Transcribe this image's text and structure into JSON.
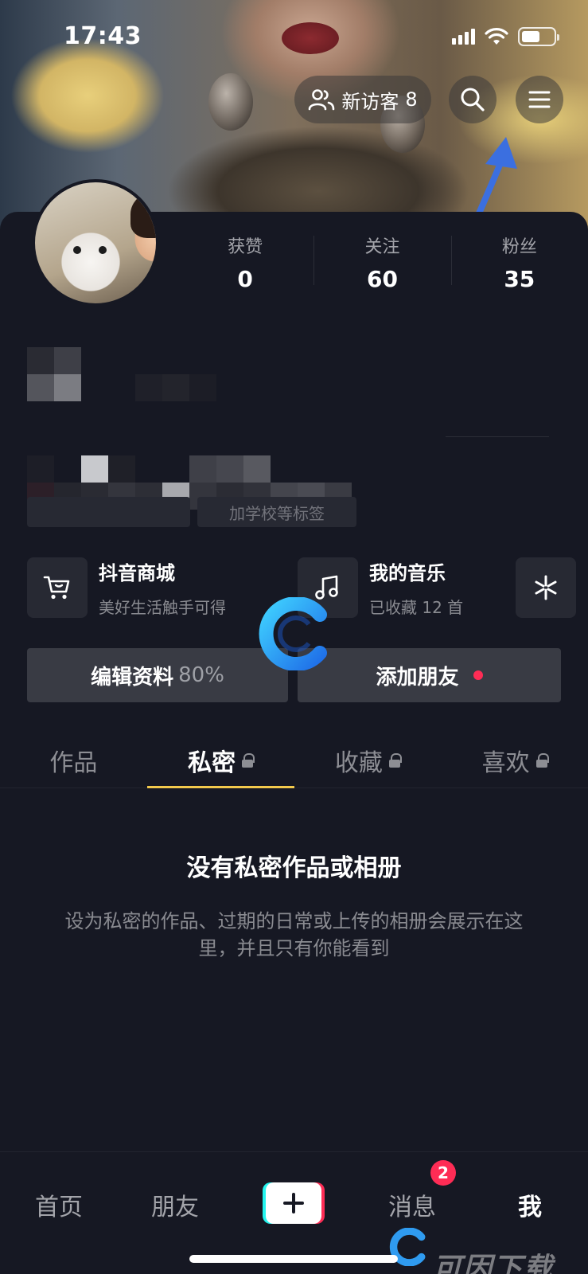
{
  "status_bar": {
    "time": "17:43"
  },
  "header": {
    "visitor_label": "新访客",
    "visitor_count": "8"
  },
  "profile": {
    "stats": [
      {
        "label": "获赞",
        "value": "0"
      },
      {
        "label": "关注",
        "value": "60"
      },
      {
        "label": "粉丝",
        "value": "35"
      }
    ],
    "tag_hint": "加学校等标签"
  },
  "features": [
    {
      "title": "抖音商城",
      "subtitle": "美好生活触手可得"
    },
    {
      "title": "我的音乐",
      "subtitle": "已收藏 12 首"
    }
  ],
  "actions": {
    "edit_label": "编辑资料",
    "edit_progress": "80%",
    "add_friend_label": "添加朋友"
  },
  "tabs": [
    {
      "label": "作品",
      "locked": false,
      "active": false
    },
    {
      "label": "私密",
      "locked": true,
      "active": true
    },
    {
      "label": "收藏",
      "locked": true,
      "active": false
    },
    {
      "label": "喜欢",
      "locked": true,
      "active": false
    }
  ],
  "empty_state": {
    "title": "没有私密作品或相册",
    "description": "设为私密的作品、过期的日常或上传的相册会展示在这里，并且只有你能看到"
  },
  "bottom_nav": {
    "items": [
      "首页",
      "朋友",
      "消息",
      "我"
    ],
    "messages_badge": "2",
    "active": "我"
  },
  "watermark": {
    "text": "可因下载"
  },
  "colors": {
    "background": "#161823",
    "accent_tab": "#f2c94c",
    "badge_red": "#fe2c55",
    "annotation_arrow": "#3b6fe0"
  }
}
